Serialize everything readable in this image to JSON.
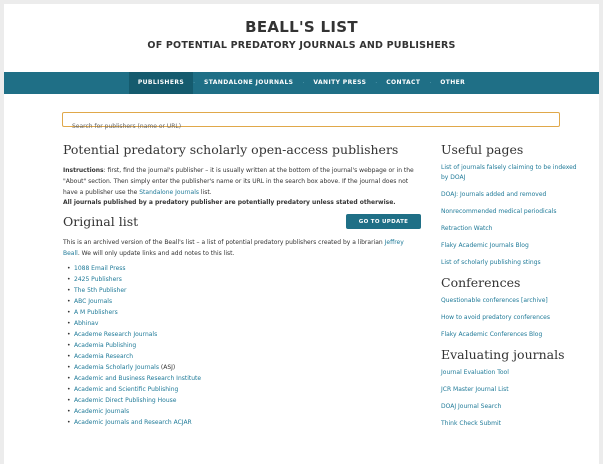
{
  "header": {
    "title": "BEALL'S LIST",
    "subtitle": "OF POTENTIAL PREDATORY JOURNALS AND PUBLISHERS"
  },
  "nav": {
    "items": [
      "PUBLISHERS",
      "STANDALONE JOURNALS",
      "VANITY PRESS",
      "CONTACT",
      "OTHER"
    ],
    "active_index": 0
  },
  "search": {
    "placeholder": "Search for publishers (name or URL)"
  },
  "main": {
    "title": "Potential predatory scholarly open-access publishers",
    "instructions_label": "Instructions",
    "instructions_text": ": first, find the journal's publisher – it is usually written at the bottom of the journal's webpage or in the \"About\" section. Then simply enter the publisher's name or its URL in the search box above. If the journal does not have a publisher use the ",
    "standalone_link": "Standalone Journals",
    "instructions_end": " list.",
    "bold_note": "All journals published by a predatory publisher are potentially predatory unless stated otherwise.",
    "original_list_title": "Original list",
    "goto_update_label": "GO TO UPDATE",
    "archived_text": "This is an archived version of the Beall's list – a list of potential predatory publishers created by a librarian ",
    "archived_link": "Jeffrey Beall",
    "archived_end": ". We will only update links and add notes to this list.",
    "publishers": [
      "1088 Email Press",
      "2425 Publishers",
      "The 5th Publisher",
      "ABC Journals",
      "A M Publishers",
      "Abhinav",
      "Academe Research Journals",
      "Academia Publishing",
      "Academia Research",
      "Academia Scholarly Journals",
      "Academic and Business Research Institute",
      "Academic and Scientific Publishing",
      "Academic Direct Publishing House",
      "Academic Journals",
      "Academic Journals and Research ACJAR"
    ],
    "publisher_suffix_9": " (ASJ)"
  },
  "sidebar": {
    "useful_title": "Useful pages",
    "useful_links": [
      "List of journals falsely claiming to be indexed by DOAJ",
      "DOAJ: Journals added and removed",
      "Nonrecommended medical periodicals",
      "Retraction Watch",
      "Flaky Academic Journals Blog",
      "List of scholarly publishing stings"
    ],
    "conferences_title": "Conferences",
    "conf_link_0": "Questionable conferences",
    "conf_link_0_archive": "[archive]",
    "conference_links": [
      "How to avoid predatory conferences",
      "Flaky Academic Conferences Blog"
    ],
    "evaluating_title": "Evaluating journals",
    "evaluating_links": [
      "Journal Evaluation Tool",
      "JCR Master Journal List",
      "DOAJ Journal Search",
      "Think Check Submit"
    ]
  },
  "colors": {
    "nav_bg": "#1f6f86",
    "link": "#1f7a98",
    "search_border": "#e0a84a"
  }
}
